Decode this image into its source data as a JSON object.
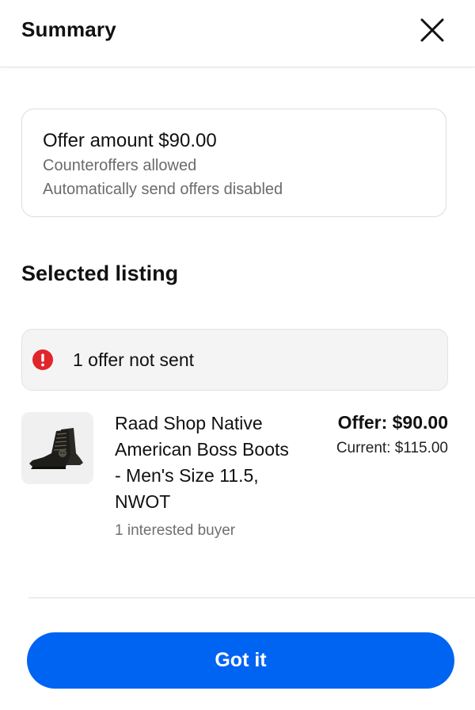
{
  "header": {
    "title": "Summary",
    "close_icon": "close-icon"
  },
  "offer": {
    "amount_text": "Offer amount $90.00",
    "counteroffers": "Counteroffers allowed",
    "auto_send": "Automatically send offers disabled"
  },
  "selected_listing": {
    "title": "Selected listing",
    "alert": {
      "icon": "error-icon",
      "text": "1 offer not sent",
      "color": "#e0262b"
    },
    "item": {
      "image_icon": "boot-thumbnail",
      "title": "Raad Shop Native American Boss Boots - Men's Size 11.5, NWOT",
      "interested": "1 interested buyer",
      "offer_price": "Offer: $90.00",
      "current_price": "Current: $115.00"
    }
  },
  "footer": {
    "button_label": "Got it",
    "button_color": "#0064f2"
  }
}
